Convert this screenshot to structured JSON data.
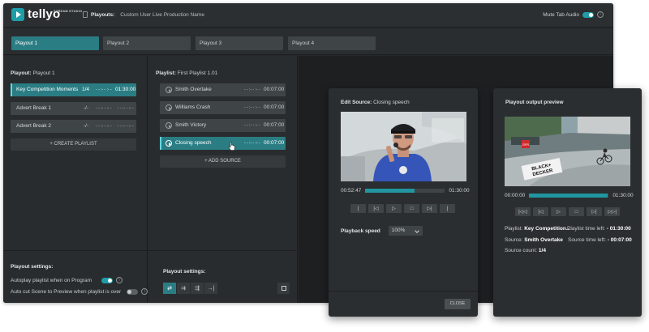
{
  "topbar": {
    "logo_text": "tellyo",
    "logo_sub": "STREAM STUDIO",
    "playouts_label": "Playouts:",
    "playouts_value": "Custom User Live Production Name",
    "mute_label": "Mute Tab Audio",
    "mute_on": true
  },
  "tabs": [
    {
      "label": "Playout 1",
      "active": true
    },
    {
      "label": "Playout 2"
    },
    {
      "label": "Playout 3"
    },
    {
      "label": "Playout 4"
    }
  ],
  "playout": {
    "title_label": "Playout:",
    "title_value": "Playout 1",
    "playlists": [
      {
        "name": "Key Competition Moments",
        "count": "1/4",
        "time": "- - :- - :- -",
        "duration": "01:30:00",
        "active": true
      },
      {
        "name": "Advert Break 1",
        "count": "-/-",
        "time": "- - :- - :- -",
        "duration": "- - :- - :- -"
      },
      {
        "name": "Advert Break 2",
        "count": "-/-",
        "time": "- - :- - :- -",
        "duration": "- - :- - :- -"
      }
    ],
    "create_label": "+ CREATE PLAYLIST",
    "settings_title": "Playout settings:",
    "autoplay_label": "Autoplay playlist when on Program",
    "autocut_label": "Auto cut Scene to Preview when playlist is over",
    "info_glyph": "i"
  },
  "playlist": {
    "title_label": "Playlist:",
    "title_value": "First Playlist 1.01",
    "sources": [
      {
        "name": "Smith Overtake",
        "time": "- - :- - :- -",
        "duration": "00:07:00"
      },
      {
        "name": "Williams Crash",
        "time": "- - :- - :- -",
        "duration": "00:07:00"
      },
      {
        "name": "Smith Victory",
        "time": "- - :- - :- -",
        "duration": "00:07:00"
      },
      {
        "name": "Closing speech",
        "time": "- - :- - :- -",
        "duration": "00:07:00",
        "active": true
      }
    ],
    "add_label": "+ ADD SOURCE",
    "settings_title": "Playout settings:",
    "mode_glyphs": [
      "⇄",
      "⇉",
      "⇶",
      "→|"
    ]
  },
  "edit_source": {
    "title_label": "Edit Source:",
    "title_value": "Closing speech",
    "time_current": "00:52:47",
    "time_total": "01:30:00",
    "progress": 0.62,
    "controls": [
      "|",
      "|◁",
      "▷",
      "□",
      "▷|",
      "|"
    ],
    "speed_label": "Playback speed",
    "speed_value": "100%",
    "close_label": "CLOSE"
  },
  "output_preview": {
    "title": "Playout output preview",
    "time_current": "00:00:00",
    "time_total": "01:30:00",
    "progress": 0.99,
    "controls": [
      "|◁◁",
      "|◁",
      "▷",
      "□",
      "▷|",
      "▷▷|"
    ],
    "banner_line1": "BLACK+",
    "banner_line2": "DECKER",
    "tag": "SFR",
    "playlist_label": "Playlist:",
    "playlist_value": "Key Competition...",
    "playlist_time_label": "Playlist time left:",
    "playlist_time_value": "- 01:30:00",
    "source_label": "Source:",
    "source_value": "Smith Overtake",
    "source_time_label": "Source time left:",
    "source_time_value": "- 00:07:00",
    "count_label": "Source count:",
    "count_value": "1/4"
  },
  "colors": {
    "accent": "#2b7d84",
    "accent_bright": "#1e9ea8",
    "background": "#26292b"
  }
}
